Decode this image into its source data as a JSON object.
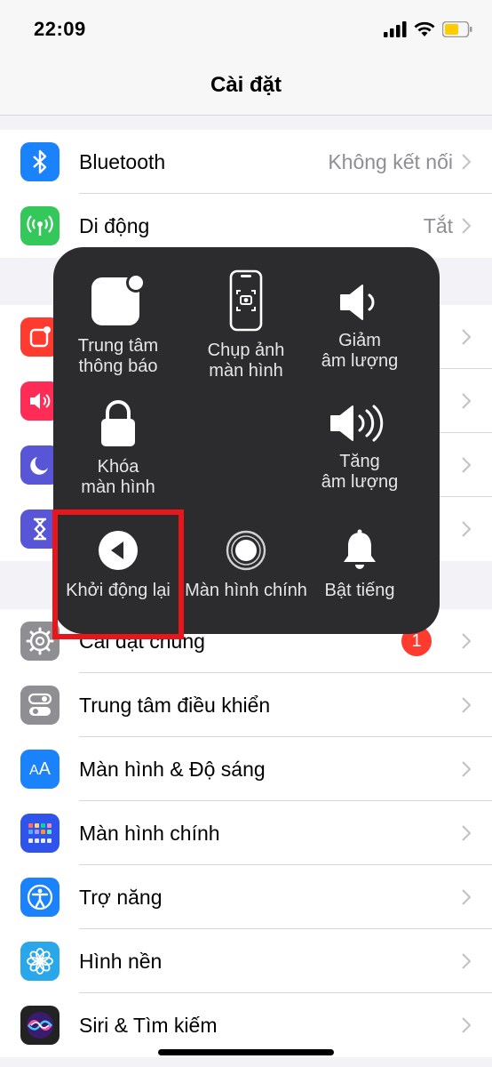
{
  "status_bar": {
    "time": "22:09"
  },
  "nav": {
    "title": "Cài đặt"
  },
  "group1": [
    {
      "label": "Bluetooth",
      "value": "Không kết nối",
      "icon": "bluetooth-icon",
      "color": "#1a82fb"
    },
    {
      "label": "Di động",
      "value": "Tắt",
      "icon": "antenna-icon",
      "color": "#34c759"
    }
  ],
  "group2_icons": [
    {
      "icon": "notifications-icon",
      "color": "#ff3b30"
    },
    {
      "icon": "sounds-icon",
      "color": "#ff2d55"
    },
    {
      "icon": "moon-icon",
      "color": "#5856d6"
    },
    {
      "icon": "hourglass-icon",
      "color": "#5856d6"
    }
  ],
  "group3": [
    {
      "label": "Cài đặt chung",
      "badge": "1",
      "icon": "gear-icon",
      "color": "#8e8e93"
    },
    {
      "label": "Trung tâm điều khiển",
      "icon": "toggles-icon",
      "color": "#8e8e93"
    },
    {
      "label": "Màn hình & Độ sáng",
      "icon": "text-size-icon",
      "color": "#1a82fb"
    },
    {
      "label": "Màn hình chính",
      "icon": "home-grid-icon",
      "color": "#2f54eb"
    },
    {
      "label": "Trợ năng",
      "icon": "accessibility-icon",
      "color": "#1a82fb"
    },
    {
      "label": "Hình nền",
      "icon": "flower-icon",
      "color": "#2aa7e8"
    },
    {
      "label": "Siri & Tìm kiếm",
      "icon": "siri-icon",
      "color": "#222222"
    }
  ],
  "assistive_menu": {
    "notification_center": "Trung tâm\nthông báo",
    "screenshot": "Chụp ảnh\nmàn hình",
    "volume_down": "Giảm\nâm lượng",
    "lock_screen": "Khóa\nmàn hình",
    "volume_up": "Tăng\nâm lượng",
    "restart": "Khởi động lại",
    "home": "Màn hình chính",
    "unmute": "Bật tiếng"
  },
  "colors": {
    "highlight": "#e8151b",
    "menu_bg": "#2c2c2e",
    "battery": "#ffcc00"
  }
}
